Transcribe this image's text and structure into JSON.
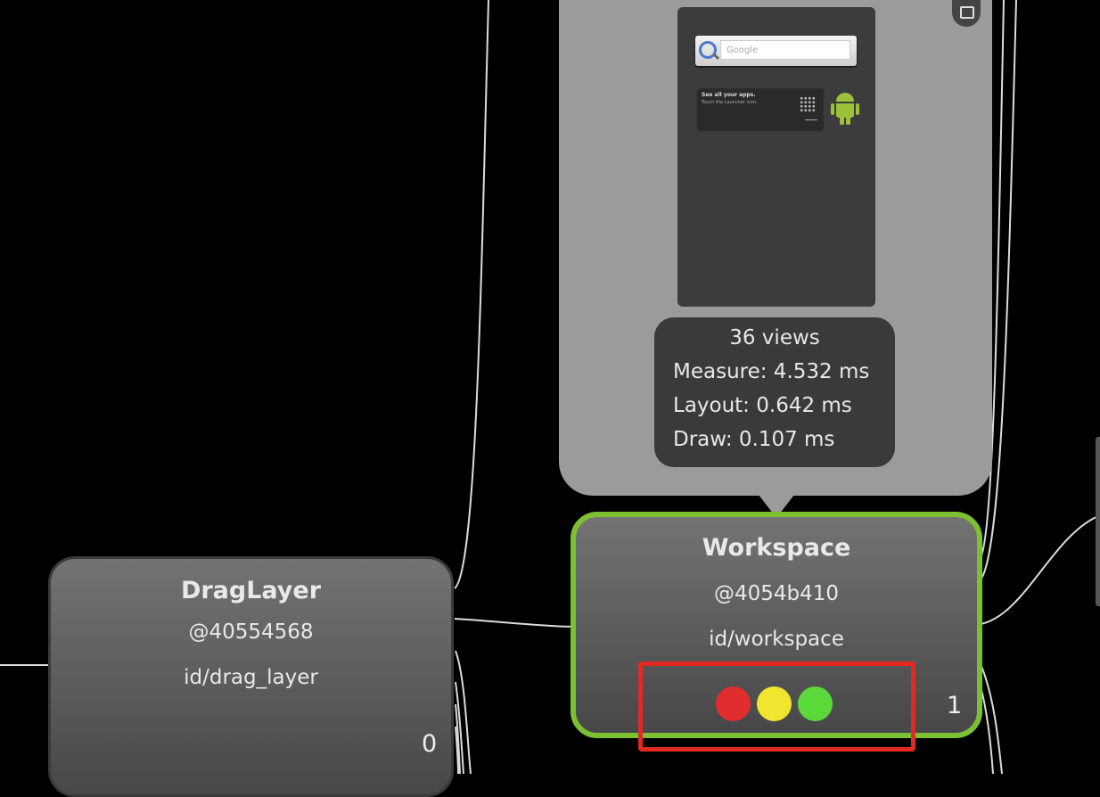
{
  "preview": {
    "search_placeholder": "Google",
    "hint_title": "See all your apps.",
    "hint_subtitle": "Touch the Launcher icon."
  },
  "stats": {
    "views": "36 views",
    "measure": "Measure: 4.532 ms",
    "layout": "Layout: 0.642 ms",
    "draw": "Draw: 0.107 ms"
  },
  "nodes": {
    "draglayer": {
      "title": "DragLayer",
      "hash": "@40554568",
      "id": "id/drag_layer",
      "index": "0"
    },
    "workspace": {
      "title": "Workspace",
      "hash": "@4054b410",
      "id": "id/workspace",
      "index": "1",
      "indicators": [
        "red",
        "yellow",
        "green"
      ]
    }
  },
  "colors": {
    "selected_border": "#7cc134",
    "highlight_box": "#e22a22",
    "indicator_red": "#e12d2d",
    "indicator_yellow": "#f1e52f",
    "indicator_green": "#5bd93b"
  }
}
